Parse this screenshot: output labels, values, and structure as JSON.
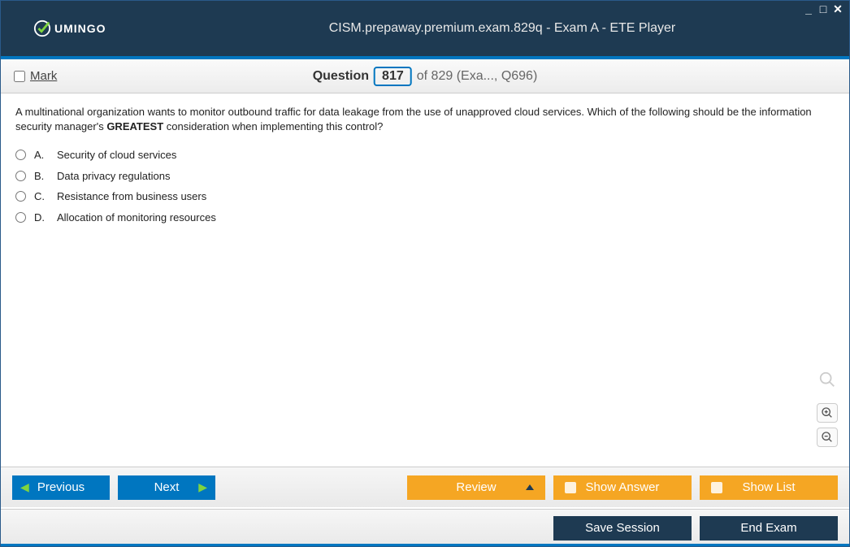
{
  "titlebar": {
    "logo_text": "UMINGO",
    "title": "CISM.prepaway.premium.exam.829q - Exam A - ETE Player"
  },
  "qbar": {
    "mark_label": "Mark",
    "question_word": "Question",
    "current": "817",
    "of_text": "of 829 (Exa..., Q696)"
  },
  "question": {
    "text_pre": "A multinational organization wants to monitor outbound traffic for data leakage from the use of unapproved cloud services. Which of the following should be the information security manager's ",
    "text_bold": "GREATEST",
    "text_post": " consideration when implementing this control?"
  },
  "options": [
    {
      "letter": "A.",
      "text": "Security of cloud services"
    },
    {
      "letter": "B.",
      "text": "Data privacy regulations"
    },
    {
      "letter": "C.",
      "text": "Resistance from business users"
    },
    {
      "letter": "D.",
      "text": "Allocation of monitoring resources"
    }
  ],
  "buttons": {
    "previous": "Previous",
    "next": "Next",
    "review": "Review",
    "show_answer": "Show Answer",
    "show_list": "Show List",
    "save_session": "Save Session",
    "end_exam": "End Exam"
  }
}
